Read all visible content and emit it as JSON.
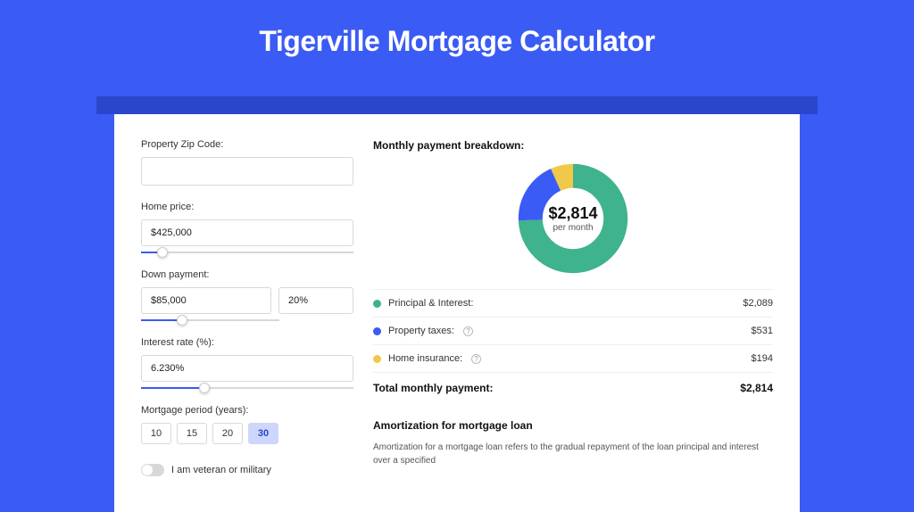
{
  "title": "Tigerville Mortgage Calculator",
  "form": {
    "zipLabel": "Property Zip Code:",
    "zipValue": "",
    "homePriceLabel": "Home price:",
    "homePriceValue": "$425,000",
    "homePriceSliderPct": 10,
    "downPaymentLabel": "Down payment:",
    "downPaymentValue": "$85,000",
    "downPaymentPct": "20%",
    "downPaymentSliderPct": 20,
    "interestLabel": "Interest rate (%):",
    "interestValue": "6.230%",
    "interestSliderPct": 30,
    "periodLabel": "Mortgage period (years):",
    "periodOptions": [
      "10",
      "15",
      "20",
      "30"
    ],
    "periodActive": "30",
    "veteranLabel": "I am veteran or military",
    "veteranOn": false
  },
  "breakdown": {
    "title": "Monthly payment breakdown:",
    "centerAmount": "$2,814",
    "centerSub": "per month",
    "items": [
      {
        "label": "Principal & Interest:",
        "amount": "$2,089",
        "color": "green",
        "info": false
      },
      {
        "label": "Property taxes:",
        "amount": "$531",
        "color": "blue",
        "info": true
      },
      {
        "label": "Home insurance:",
        "amount": "$194",
        "color": "yellow",
        "info": true
      }
    ],
    "totalLabel": "Total monthly payment:",
    "totalAmount": "$2,814"
  },
  "chart_data": {
    "type": "pie",
    "title": "Monthly payment breakdown",
    "series": [
      {
        "name": "Principal & Interest",
        "value": 2089,
        "color": "#3fb28e"
      },
      {
        "name": "Property taxes",
        "value": 531,
        "color": "#3b5bf5"
      },
      {
        "name": "Home insurance",
        "value": 194,
        "color": "#f0c94a"
      }
    ],
    "total": 2814,
    "center_label": "$2,814 per month"
  },
  "amortization": {
    "title": "Amortization for mortgage loan",
    "text": "Amortization for a mortgage loan refers to the gradual repayment of the loan principal and interest over a specified"
  }
}
